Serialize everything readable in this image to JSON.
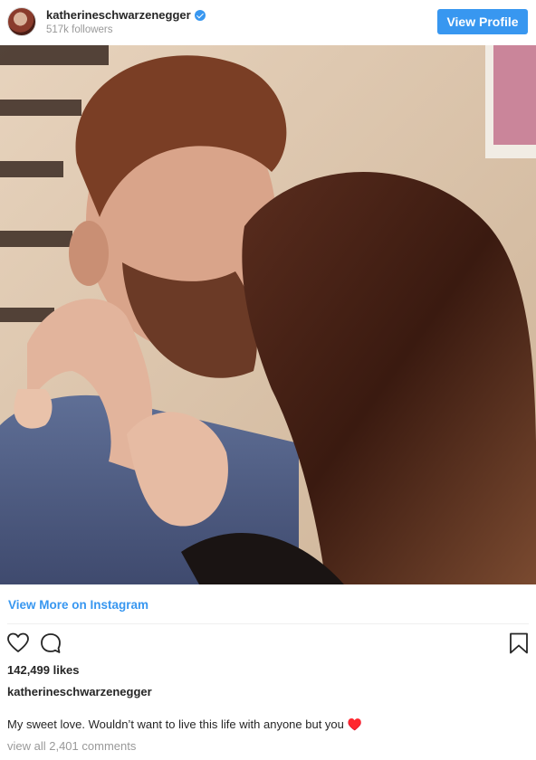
{
  "header": {
    "username": "katherineschwarzenegger",
    "followers": "517k followers",
    "view_profile_label": "View Profile",
    "verified_badge_icon": "verified-check-icon"
  },
  "post": {
    "photo_icon": "post-photo",
    "view_more_label": "View More on Instagram",
    "actions": {
      "like_icon": "heart-icon",
      "comment_icon": "comment-bubble-icon",
      "save_icon": "bookmark-icon"
    },
    "likes": "142,499 likes",
    "owner": "katherineschwarzenegger",
    "caption": "My sweet love. Wouldn’t want to live this life with anyone but you ♥️",
    "comments_link": "view all 2,401 comments"
  },
  "colors": {
    "accent": "#3897f0",
    "text": "#262626",
    "muted": "#999999"
  }
}
